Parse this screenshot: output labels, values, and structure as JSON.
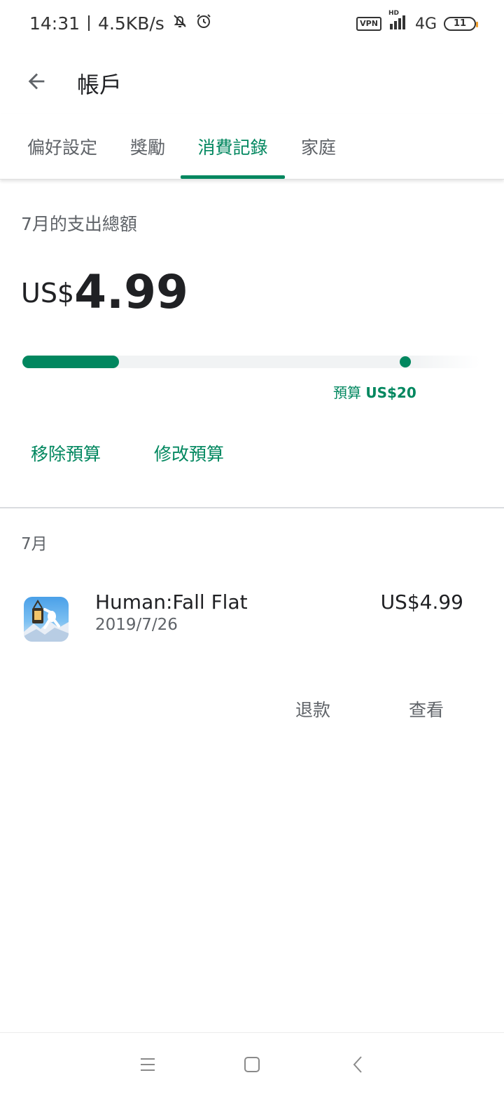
{
  "status_bar": {
    "time": "14:31",
    "speed": "4.5KB/s",
    "vpn": "VPN",
    "hd": "HD",
    "network": "4G",
    "battery": "11"
  },
  "app_bar": {
    "title": "帳戶"
  },
  "tabs": [
    {
      "label": "偏好設定",
      "active": false
    },
    {
      "label": "獎勵",
      "active": false
    },
    {
      "label": "消費記錄",
      "active": true
    },
    {
      "label": "家庭",
      "active": false
    }
  ],
  "spending": {
    "label": "7月的支出總額",
    "currency": "US$",
    "amount": "4.99",
    "progress_fraction": 0.2495,
    "budget_prefix": "預算",
    "budget_value": "US$20",
    "remove_budget": "移除預算",
    "edit_budget": "修改預算"
  },
  "history": {
    "month_header": "7月",
    "items": [
      {
        "name": "Human:Fall Flat",
        "date": "2019/7/26",
        "price": "US$4.99",
        "refund_label": "退款",
        "view_label": "查看"
      }
    ]
  },
  "colors": {
    "accent": "#01875f",
    "text_primary": "#202124",
    "text_secondary": "#5f6368"
  }
}
